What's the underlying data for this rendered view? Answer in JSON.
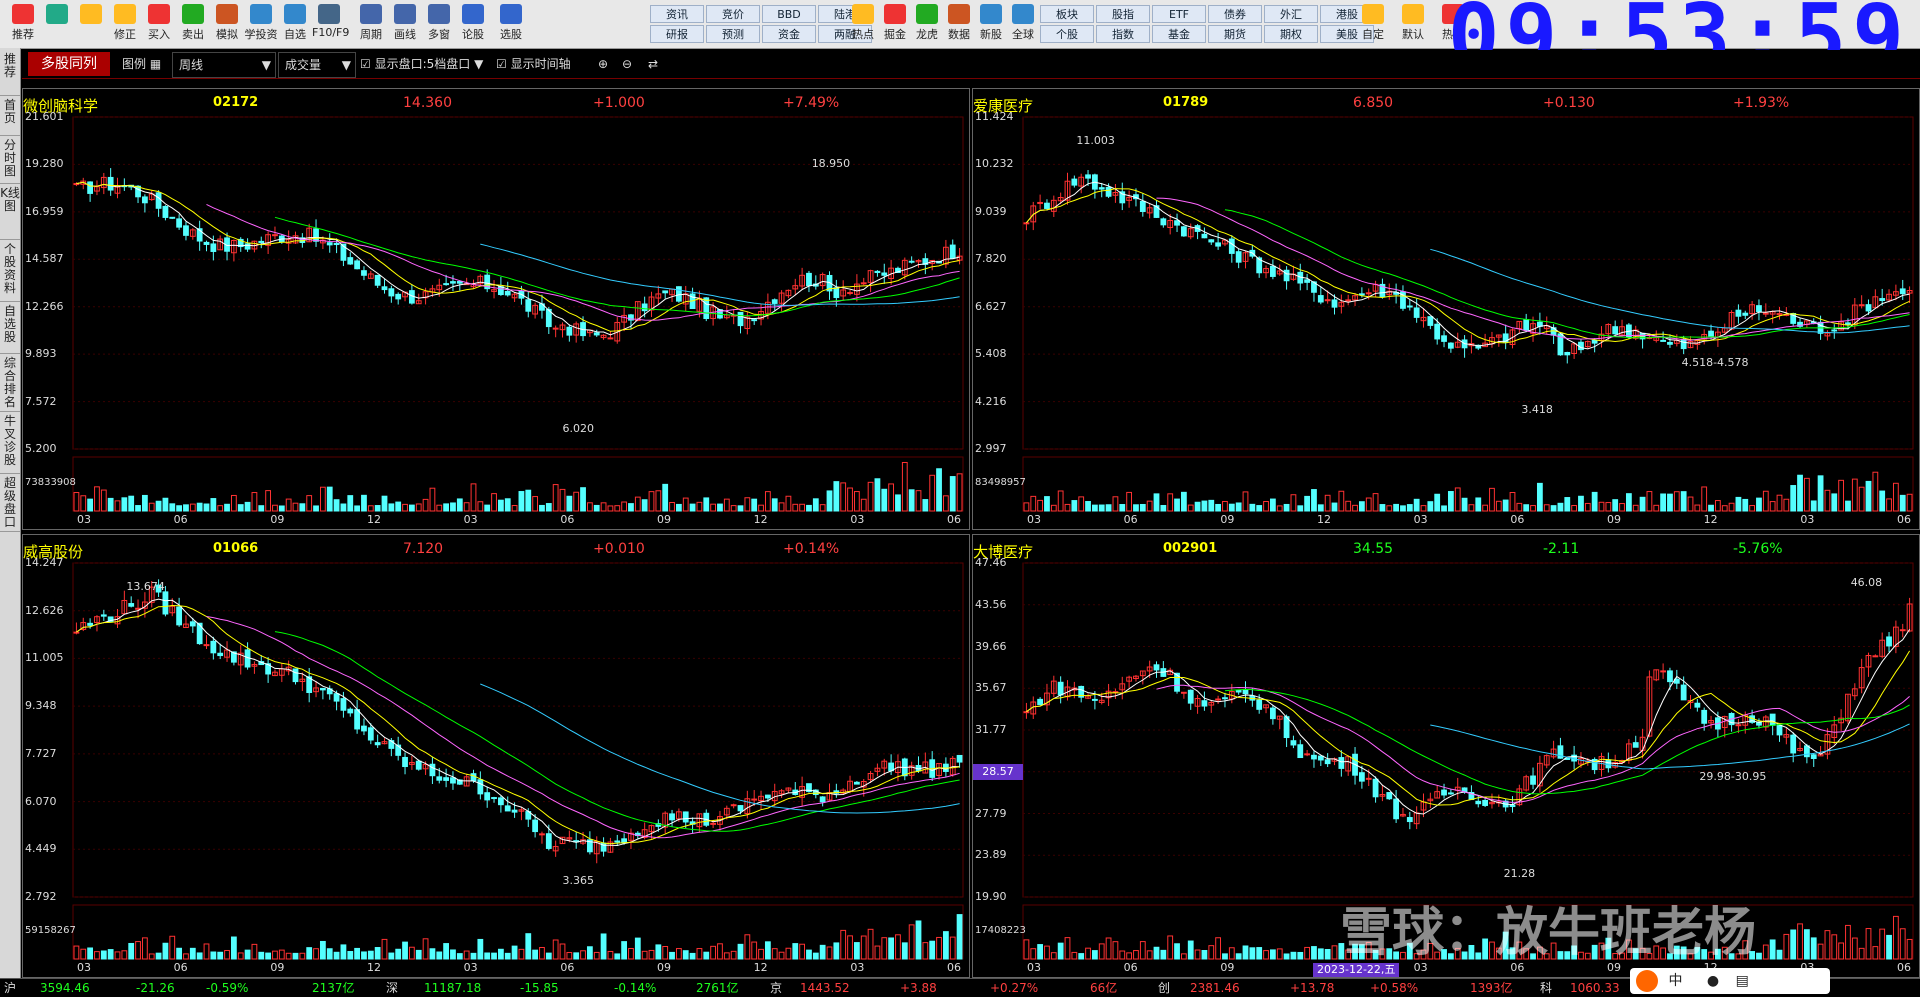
{
  "clock": "09:53:59",
  "toolbar": {
    "buttons": [
      {
        "label": "推荐",
        "icon": "grid-icon"
      },
      {
        "label": "",
        "icon": "chat-icon"
      },
      {
        "label": "",
        "icon": "back-arrow-icon"
      },
      {
        "label": "修正",
        "icon": "updown-icon"
      },
      {
        "label": "买入",
        "icon": "buy-icon"
      },
      {
        "label": "卖出",
        "icon": "sell-icon"
      },
      {
        "label": "模拟",
        "icon": "hammer-icon"
      },
      {
        "label": "学投资",
        "icon": "school-icon"
      },
      {
        "label": "自选",
        "icon": "home-icon"
      },
      {
        "label": "F10/F9",
        "icon": "f10-icon"
      },
      {
        "label": "周期",
        "icon": "clock-icon"
      },
      {
        "label": "画线",
        "icon": "pencil-icon"
      },
      {
        "label": "多窗",
        "icon": "windows-icon"
      },
      {
        "label": "论股",
        "icon": "forum-icon"
      },
      {
        "label": "选股",
        "icon": "target-icon"
      }
    ],
    "grid": [
      [
        "资讯",
        "竞价",
        "BBD",
        "陆港"
      ],
      [
        "研报",
        "预测",
        "资金",
        "两融"
      ]
    ],
    "buttons2": [
      {
        "label": "热点",
        "icon": "hot-icon"
      },
      {
        "label": "掘金",
        "icon": "gold-icon"
      },
      {
        "label": "龙虎",
        "icon": "dragon-icon"
      },
      {
        "label": "数据",
        "icon": "pe-icon"
      },
      {
        "label": "新股",
        "icon": "new-icon"
      },
      {
        "label": "全球",
        "icon": "globe-icon"
      }
    ],
    "grid2": [
      [
        "板块",
        "股指",
        "ETF",
        "债券",
        "外汇",
        "港股"
      ],
      [
        "个股",
        "指数",
        "基金",
        "期货",
        "期权",
        "美股"
      ]
    ],
    "buttons3": [
      {
        "label": "自定",
        "icon": "custom-icon"
      },
      {
        "label": "默认",
        "icon": "house-icon"
      },
      {
        "label": "热搜",
        "icon": "shield-icon"
      }
    ]
  },
  "tabbar": {
    "active_tab": "多股同列",
    "layout_label": "图例",
    "period": "周线",
    "indicator": "成交量",
    "opt1": "显示盘口:5档盘口",
    "opt2": "显示时间轴"
  },
  "sidebar": [
    "推荐",
    "首页",
    "分时图",
    "K线图",
    "个股资料",
    "自选股",
    "综合排名",
    "牛叉诊股",
    "超级盘口"
  ],
  "panels": [
    {
      "name": "微创脑科学",
      "code": "02172",
      "price": "14.360",
      "change": "+1.000",
      "pct": "+7.49%",
      "dir": "up",
      "yticks": [
        "21.601",
        "19.280",
        "16.959",
        "14.587",
        "12.266",
        "9.893",
        "7.572",
        "5.200"
      ],
      "vol_label": "73833908",
      "xticks": [
        "03",
        "06",
        "09",
        "12",
        "03",
        "06",
        "09",
        "12",
        "03",
        "06"
      ],
      "annotations": [
        "18.950",
        "6.020"
      ]
    },
    {
      "name": "爱康医疗",
      "code": "01789",
      "price": "6.850",
      "change": "+0.130",
      "pct": "+1.93%",
      "dir": "up",
      "yticks": [
        "11.424",
        "10.232",
        "9.039",
        "7.820",
        "6.627",
        "5.408",
        "4.216",
        "2.997"
      ],
      "vol_label": "83498957",
      "xticks": [
        "03",
        "06",
        "09",
        "12",
        "03",
        "06",
        "09",
        "12",
        "03",
        "06"
      ],
      "annotations": [
        "11.003",
        "3.418",
        "4.518-4.578"
      ]
    },
    {
      "name": "威高股份",
      "code": "01066",
      "price": "7.120",
      "change": "+0.010",
      "pct": "+0.14%",
      "dir": "up",
      "yticks": [
        "14.247",
        "12.626",
        "11.005",
        "9.348",
        "7.727",
        "6.070",
        "4.449",
        "2.792"
      ],
      "vol_label": "59158267",
      "xticks": [
        "03",
        "06",
        "09",
        "12",
        "03",
        "06",
        "09",
        "12",
        "03",
        "06"
      ],
      "annotations": [
        "13.674",
        "3.365"
      ]
    },
    {
      "name": "大博医疗",
      "code": "002901",
      "price": "34.55",
      "change": "-2.11",
      "pct": "-5.76%",
      "dir": "down",
      "yticks": [
        "47.46",
        "43.56",
        "39.66",
        "35.67",
        "31.77",
        "28.57",
        "27.79",
        "23.89",
        "19.90"
      ],
      "vol_label": "17408223",
      "xticks": [
        "03",
        "06",
        "09",
        "12",
        "03",
        "06",
        "09",
        "12",
        "03",
        "06"
      ],
      "annotations": [
        "46.08",
        "21.28",
        "29.98-30.95"
      ],
      "date_badge": "2023-12-22,五"
    }
  ],
  "statusbar": [
    {
      "text": "沪",
      "cls": ""
    },
    {
      "text": "3594.46",
      "cls": "down"
    },
    {
      "text": "-21.26",
      "cls": "down"
    },
    {
      "text": "-0.59%",
      "cls": "down"
    },
    {
      "text": "2137亿",
      "cls": "down"
    },
    {
      "text": "深",
      "cls": ""
    },
    {
      "text": "11187.18",
      "cls": "down"
    },
    {
      "text": "-15.85",
      "cls": "down"
    },
    {
      "text": "-0.14%",
      "cls": "down"
    },
    {
      "text": "2761亿",
      "cls": "down"
    },
    {
      "text": "京",
      "cls": ""
    },
    {
      "text": "1443.52",
      "cls": "up"
    },
    {
      "text": "+3.88",
      "cls": "up"
    },
    {
      "text": "+0.27%",
      "cls": "up"
    },
    {
      "text": "66亿",
      "cls": "up"
    },
    {
      "text": "创",
      "cls": ""
    },
    {
      "text": "2381.46",
      "cls": "up"
    },
    {
      "text": "+13.78",
      "cls": "up"
    },
    {
      "text": "+0.58%",
      "cls": "up"
    },
    {
      "text": "1393亿",
      "cls": "up"
    },
    {
      "text": "科",
      "cls": ""
    },
    {
      "text": "1060.33",
      "cls": "up"
    }
  ],
  "watermark": "雪球：放牛班老杨",
  "ime": "中"
}
